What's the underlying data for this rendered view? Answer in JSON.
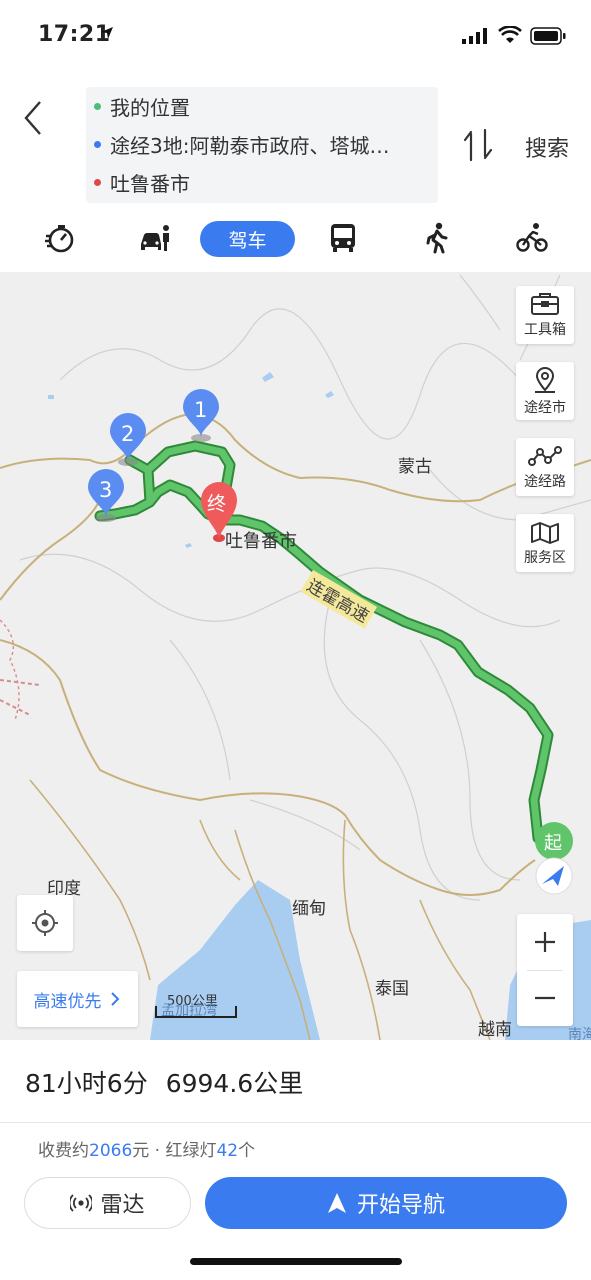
{
  "status_bar": {
    "time": "17:21"
  },
  "header": {
    "waypoints": [
      {
        "text": "我的位置",
        "color": "#4bbf73"
      },
      {
        "text": "途经3地:阿勒泰市政府、塔城…",
        "color": "#3a7cf0"
      },
      {
        "text": "吐鲁番市",
        "color": "#e04848"
      }
    ],
    "search_label": "搜索"
  },
  "modes": {
    "active_label": "驾车",
    "items": [
      "taxi-icon",
      "ride-hailing-icon",
      "car",
      "bus-icon",
      "walk-icon",
      "bike-icon"
    ]
  },
  "map": {
    "labels": {
      "mongolia": "蒙古",
      "turpan": "吐鲁番市",
      "india": "印度",
      "myanmar": "缅甸",
      "thailand": "泰国",
      "vietnam": "越南",
      "south_sea": "南海",
      "bay_of_bengal": "孟加拉湾"
    },
    "road_name": "连霍高速",
    "markers": {
      "end": "终",
      "start": "起",
      "waypoints": [
        "1",
        "2",
        "3"
      ]
    },
    "tools": [
      "工具箱",
      "途经市",
      "途经路",
      "服务区"
    ],
    "route_pref": "高速优先",
    "scale": "500公里",
    "route_color": "#4caf50"
  },
  "summary": {
    "duration": "81小时6分",
    "distance": "6994.6公里",
    "toll_prefix": "收费约",
    "toll_value": "2066",
    "toll_suffix": "元",
    "sep": " · ",
    "lights_prefix": "红绿灯",
    "lights_value": "42",
    "lights_suffix": "个"
  },
  "actions": {
    "radar": "雷达",
    "start_nav": "开始导航"
  }
}
